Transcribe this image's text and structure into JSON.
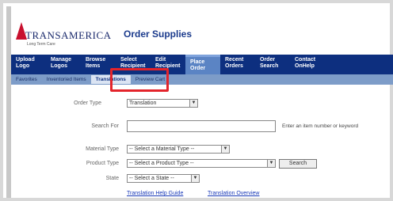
{
  "brand": {
    "name": "TRANSAMERICA",
    "tagline": "Long Term Care",
    "app_title": "Order Supplies",
    "accent": "#c8102e",
    "nav_color": "#0d2f7f"
  },
  "topnav": [
    {
      "label": "Upload Logo"
    },
    {
      "label": "Manage Logos"
    },
    {
      "label": "Browse Items"
    },
    {
      "label": "Select Recipient"
    },
    {
      "label": "Edit Recipient"
    },
    {
      "label": "Place Order"
    },
    {
      "label": "Recent Orders"
    },
    {
      "label": "Order Search"
    },
    {
      "label": "Contact OnHelp"
    }
  ],
  "subnav": [
    {
      "label": "Favorites"
    },
    {
      "label": "Inventoried Items"
    },
    {
      "label": "Translations"
    },
    {
      "label": "Preview Cart"
    }
  ],
  "form": {
    "order_type_label": "Order Type",
    "order_type_value": "Translation",
    "search_label": "Search For",
    "search_hint": "Enter an item number or keyword",
    "material_type_label": "Material Type",
    "material_type_value": "-- Select a Material Type --",
    "product_type_label": "Product Type",
    "product_type_value": "-- Select a Product Type --",
    "search_button": "Search",
    "state_label": "State",
    "state_value": "-- Select a State --"
  },
  "links": {
    "help": "Translation Help Guide",
    "overview": "Translation Overview"
  }
}
